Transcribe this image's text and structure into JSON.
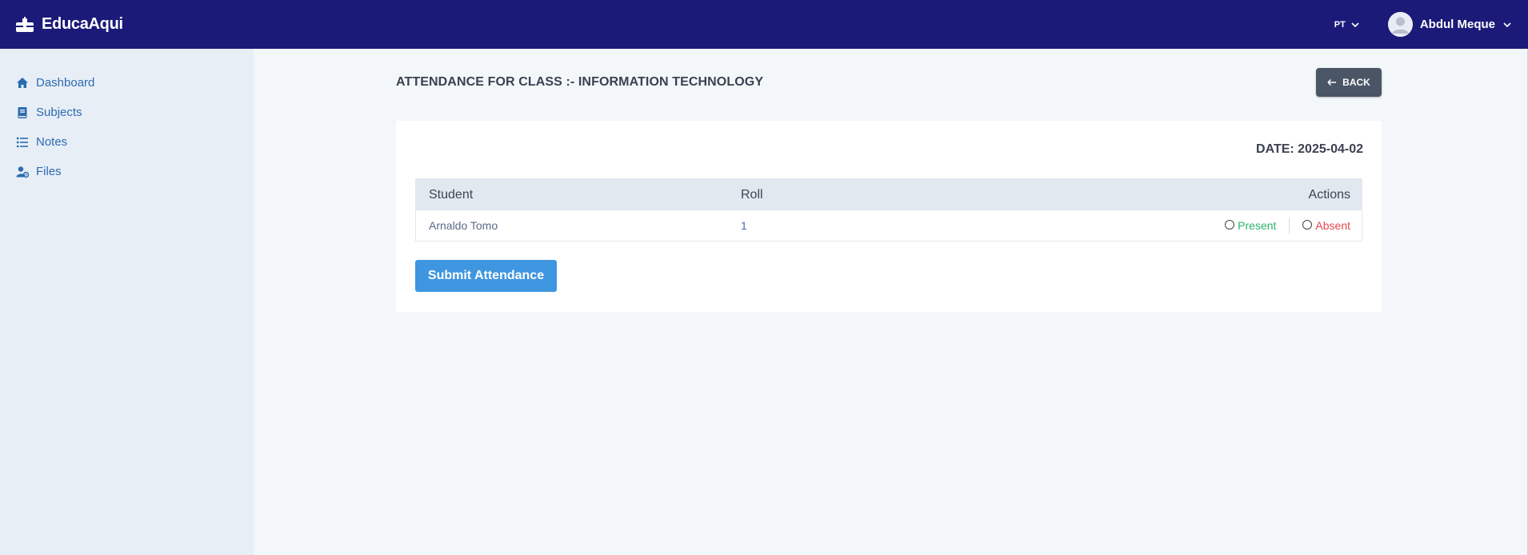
{
  "app": {
    "name": "EducaAqui",
    "brand_color": "#1b1a79"
  },
  "header": {
    "language": "PT",
    "user_name": "Abdul Meque"
  },
  "sidebar": {
    "items": [
      {
        "label": "Dashboard",
        "icon": "home-icon"
      },
      {
        "label": "Subjects",
        "icon": "book-icon"
      },
      {
        "label": "Notes",
        "icon": "list-icon"
      },
      {
        "label": "Files",
        "icon": "user-gear-icon"
      }
    ]
  },
  "main": {
    "title": "ATTENDANCE FOR CLASS :- INFORMATION TECHNOLOGY",
    "back_label": "BACK",
    "date_label": "DATE: 2025-04-02",
    "table": {
      "headers": [
        "Student",
        "Roll",
        "Actions"
      ],
      "rows": [
        {
          "student": "Arnaldo Tomo",
          "roll": "1",
          "present_label": "Present",
          "absent_label": "Absent"
        }
      ]
    },
    "submit_label": "Submit Attendance"
  },
  "colors": {
    "present": "#2bb36a",
    "absent": "#e5484d",
    "submit": "#3f96e0",
    "back": "#4a5566"
  }
}
